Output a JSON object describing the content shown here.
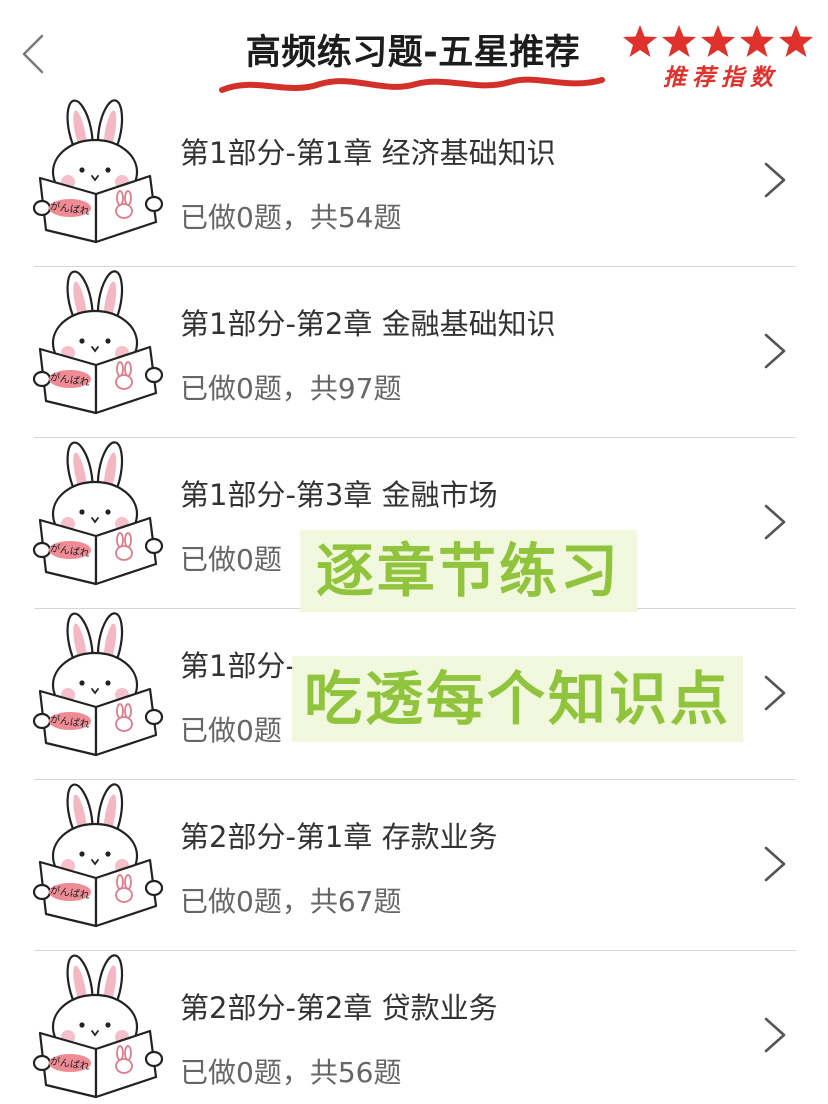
{
  "header": {
    "title": "高频练习题-五星推荐",
    "rating_label": "推荐指数",
    "rating_stars": 5,
    "accent_color": "#e0322d"
  },
  "icons": {
    "back": "chevron-left-icon",
    "row_arrow": "chevron-right-icon",
    "row_image": "bunny-reading-icon"
  },
  "bunny_book_text": "がんばれ",
  "chapters": [
    {
      "title": "第1部分-第1章  经济基础知识",
      "progress": "已做0题，共54题"
    },
    {
      "title": "第1部分-第2章  金融基础知识",
      "progress": "已做0题，共97题"
    },
    {
      "title": "第1部分-第3章  金融市场",
      "progress": "已做0题"
    },
    {
      "title": "第1部分-",
      "progress": "已做0题"
    },
    {
      "title": "第2部分-第1章  存款业务",
      "progress": "已做0题，共67题"
    },
    {
      "title": "第2部分-第2章  贷款业务",
      "progress": "已做0题，共56题"
    }
  ],
  "overlays": {
    "line1": "逐章节练习",
    "line2": "吃透每个知识点",
    "text_color": "#8fc43c"
  }
}
